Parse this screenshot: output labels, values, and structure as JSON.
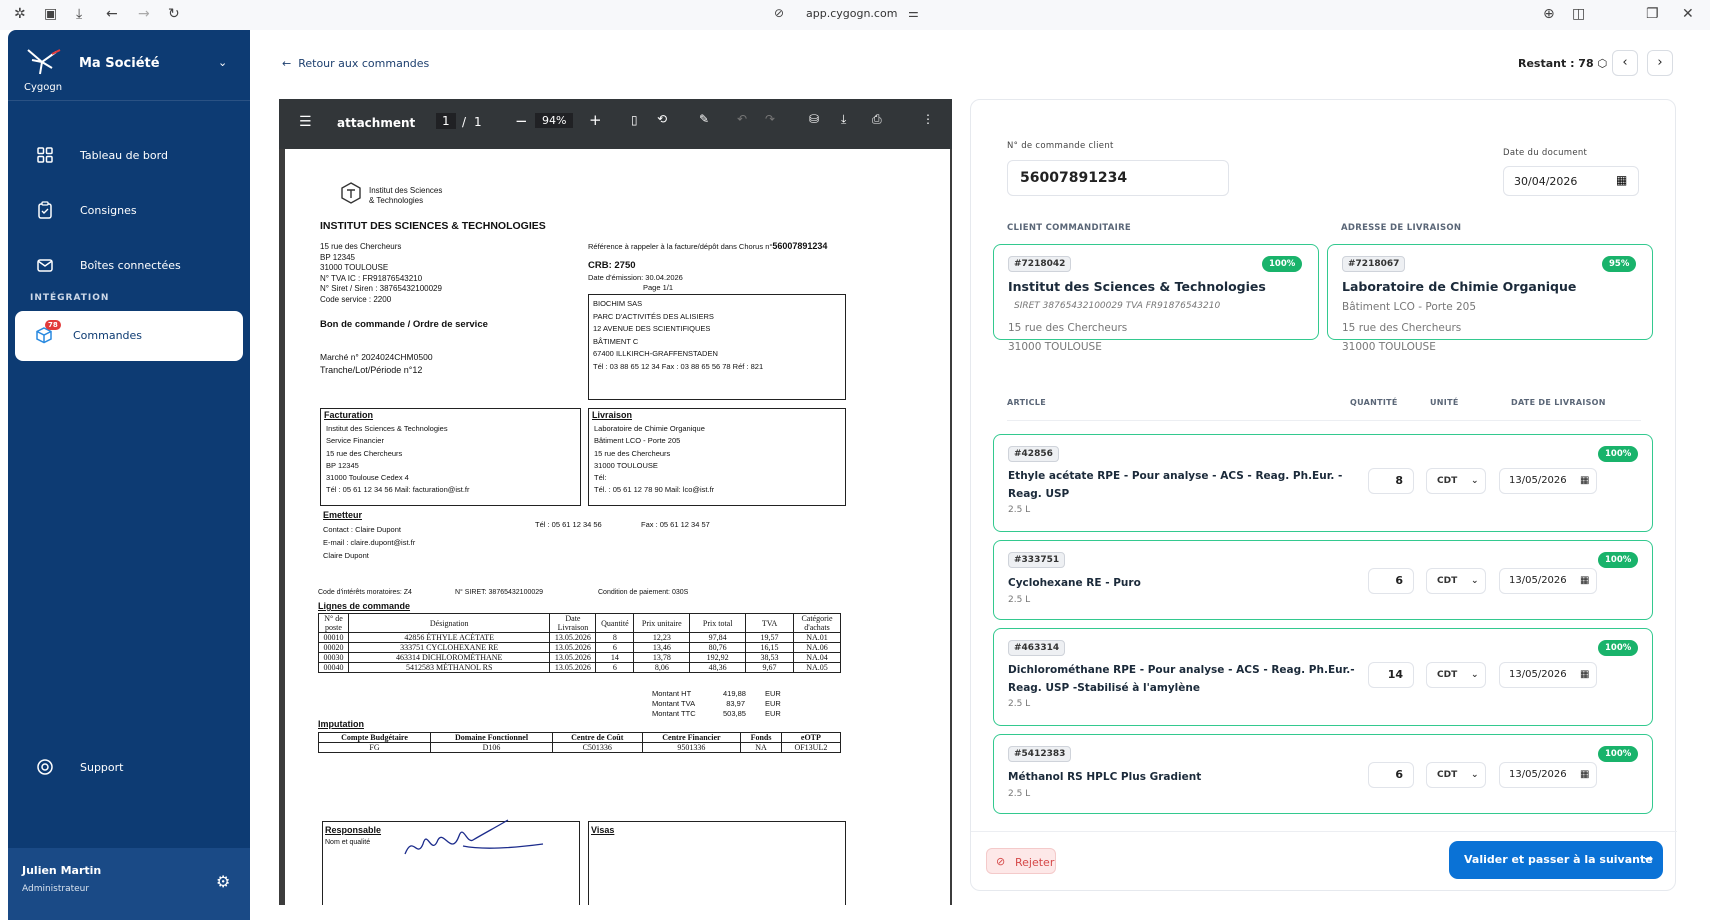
{
  "browser": {
    "url": "app.cygogn.com"
  },
  "sidebar": {
    "brand": "Cygogn",
    "company": "Ma Société",
    "items": [
      {
        "label": "Tableau de bord"
      },
      {
        "label": "Consignes"
      },
      {
        "label": "Boîtes connectées"
      }
    ],
    "section_title": "INTÉGRATION",
    "active_item": {
      "label": "Commandes",
      "badge": "78"
    },
    "support": "Support",
    "user": {
      "name": "Julien Martin",
      "role": "Administrateur"
    }
  },
  "header": {
    "back": "Retour aux commandes",
    "remaining": "Restant : 78"
  },
  "pdf": {
    "toolbar": {
      "filename": "attachment",
      "page": "1",
      "of": "/",
      "total": "1",
      "zoom": "94%"
    },
    "doc": {
      "logo_line1": "Institut des Sciences",
      "logo_line2": "& Technologies",
      "institute": "INSTITUT DES SCIENCES & TECHNOLOGIES",
      "addr": [
        "15 rue des Chercheurs",
        "BP 12345",
        "31000 TOULOUSE",
        "N° TVA IC : FR91876543210",
        "N° Siret / Siren : 38765432100029",
        "Code service : 2200"
      ],
      "ref_label": "Référence à rappeler à la facture/dépôt dans Chorus n°",
      "ref_value": "56007891234",
      "crb": "CRB:   2750",
      "emission": "Date d'émission: 30.04.2026",
      "page": "Page      1/1",
      "order_title": "Bon de commande / Ordre de service",
      "marche": "Marché n°     2024024CHM0500",
      "tranche": "Tranche/Lot/Période n°12",
      "supplier": [
        "BIOCHIM SAS",
        "PARC D'ACTIVITÉS DES ALISIERS",
        "12 AVENUE DES SCIENTIFIQUES",
        "BÂTIMENT C",
        "67400 ILLKIRCH-GRAFFENSTADEN",
        "Tél :  03 88 65 12 34       Fax :  03 88 65 56 78       Réf :  821"
      ],
      "facturation_title": "Facturation",
      "facturation": [
        "Institut des Sciences & Technologies",
        "Service Financier",
        "15 rue des Chercheurs",
        "BP 12345",
        "31000 Toulouse Cedex 4",
        "Tél :  05 61 12 34 56       Mail: facturation@ist.fr"
      ],
      "livraison_title": "Livraison",
      "livraison": [
        "Laboratoire de Chimie Organique",
        "Bâtiment LCO - Porte 205",
        "15 rue des Chercheurs",
        "31000 TOULOUSE",
        "Tél:",
        "Tél. :  05 61 12 78 90       Mail:  lco@ist.fr"
      ],
      "emetteur_title": "Emetteur",
      "emetteur": [
        "Contact : Claire Dupont",
        "E-mail :      claire.dupont@ist.fr",
        "Claire Dupont"
      ],
      "emetteur_tel": "Tél :  05 61 12 34 56",
      "emetteur_fax": "Fax :  05 61 12 34 57",
      "interets": "Code d'intérêts moratoires: Z4",
      "siret": "N° SIRET: 38765432100029",
      "paiement": "Condition de paiement: 030S",
      "lines_title": "Lignes de commande",
      "lines_head": [
        "N° de poste",
        "Désignation",
        "Date Livraison",
        "Quantité",
        "Prix unitaire",
        "Prix total",
        "TVA",
        "Catégorie d'achats"
      ],
      "lines": [
        [
          "00010",
          "42856 ÉTHYLE ACÉTATE",
          "13.05.2026",
          "8",
          "12,23",
          "97,84",
          "19,57",
          "NA.01"
        ],
        [
          "00020",
          "333751 CYCLOHEXANE RE",
          "13.05.2026",
          "6",
          "13,46",
          "80,76",
          "16,15",
          "NA.06"
        ],
        [
          "00030",
          "463314 DICHLOROMÉTHANE",
          "13.05.2026",
          "14",
          "13,78",
          "192,92",
          "38,53",
          "NA.04"
        ],
        [
          "00040",
          "5412583 MÉTHANOL RS",
          "13.05.2026",
          "6",
          "8,06",
          "48,36",
          "9,67",
          "NA.05"
        ]
      ],
      "totals": [
        [
          "Montant HT",
          "419,88",
          "EUR"
        ],
        [
          "Montant TVA",
          "83,97",
          "EUR"
        ],
        [
          "Montant TTC",
          "503,85",
          "EUR"
        ]
      ],
      "imputation_title": "Imputation",
      "imp_head": [
        "Compte Budgétaire",
        "Domaine Fonctionnel",
        "Centre de Coût",
        "Centre Financier",
        "Fonds",
        "eOTP"
      ],
      "imp_row": [
        "FG",
        "D106",
        "C501336",
        "9501336",
        "NA",
        "OF13UL2"
      ],
      "responsable": "Responsable",
      "nom_qualite": "Nom et qualité",
      "visas": "Visas"
    }
  },
  "form": {
    "order_label": "N° de commande client",
    "order_value": "56007891234",
    "date_label": "Date du document",
    "date_value": "30/04/2026",
    "client_section": "CLIENT COMMANDITAIRE",
    "delivery_section": "ADRESSE DE LIVRAISON",
    "client": {
      "id": "#7218042",
      "pct": "100%",
      "name": "Institut des Sciences & Technologies",
      "meta": "SIRET 38765432100029   TVA FR91876543210",
      "addr1": "15 rue des Chercheurs",
      "addr2": "31000 TOULOUSE"
    },
    "delivery": {
      "id": "#7218067",
      "pct": "95%",
      "name": "Laboratoire de Chimie Organique",
      "building": "Bâtiment LCO - Porte 205",
      "addr1": "15 rue des Chercheurs",
      "addr2": "31000 TOULOUSE"
    },
    "columns": {
      "article": "ARTICLE",
      "qty": "QUANTITÉ",
      "unit": "UNITÉ",
      "date": "DATE DE LIVRAISON"
    },
    "lines": [
      {
        "id": "#42856",
        "pct": "100%",
        "name1": "Ethyle acétate RPE - Pour analyse - ACS - Reag. Ph.Eur. -",
        "name2": "Reag. USP",
        "size": "2.5 L",
        "qty": "8",
        "unit": "CDT",
        "date": "13/05/2026"
      },
      {
        "id": "#333751",
        "pct": "100%",
        "name1": "Cyclohexane RE - Puro",
        "name2": "",
        "size": "2.5 L",
        "qty": "6",
        "unit": "CDT",
        "date": "13/05/2026"
      },
      {
        "id": "#463314",
        "pct": "100%",
        "name1": "Dichlorométhane RPE - Pour analyse - ACS - Reag. Ph.Eur.-",
        "name2": "Reag. USP -Stabilisé à l'amylène",
        "size": "2.5 L",
        "qty": "14",
        "unit": "CDT",
        "date": "13/05/2026"
      },
      {
        "id": "#5412383",
        "pct": "100%",
        "name1": "Méthanol RS HPLC Plus Gradient",
        "name2": "",
        "size": "2.5 L",
        "qty": "6",
        "unit": "CDT",
        "date": "13/05/2026"
      }
    ],
    "reject": "Rejeter",
    "validate": "Valider et passer à la suivante"
  },
  "colors": {
    "sidebar": "#0d3b73",
    "accent_green": "#19b36b",
    "primary_blue": "#0a72d6",
    "reject_red": "#d54848"
  }
}
